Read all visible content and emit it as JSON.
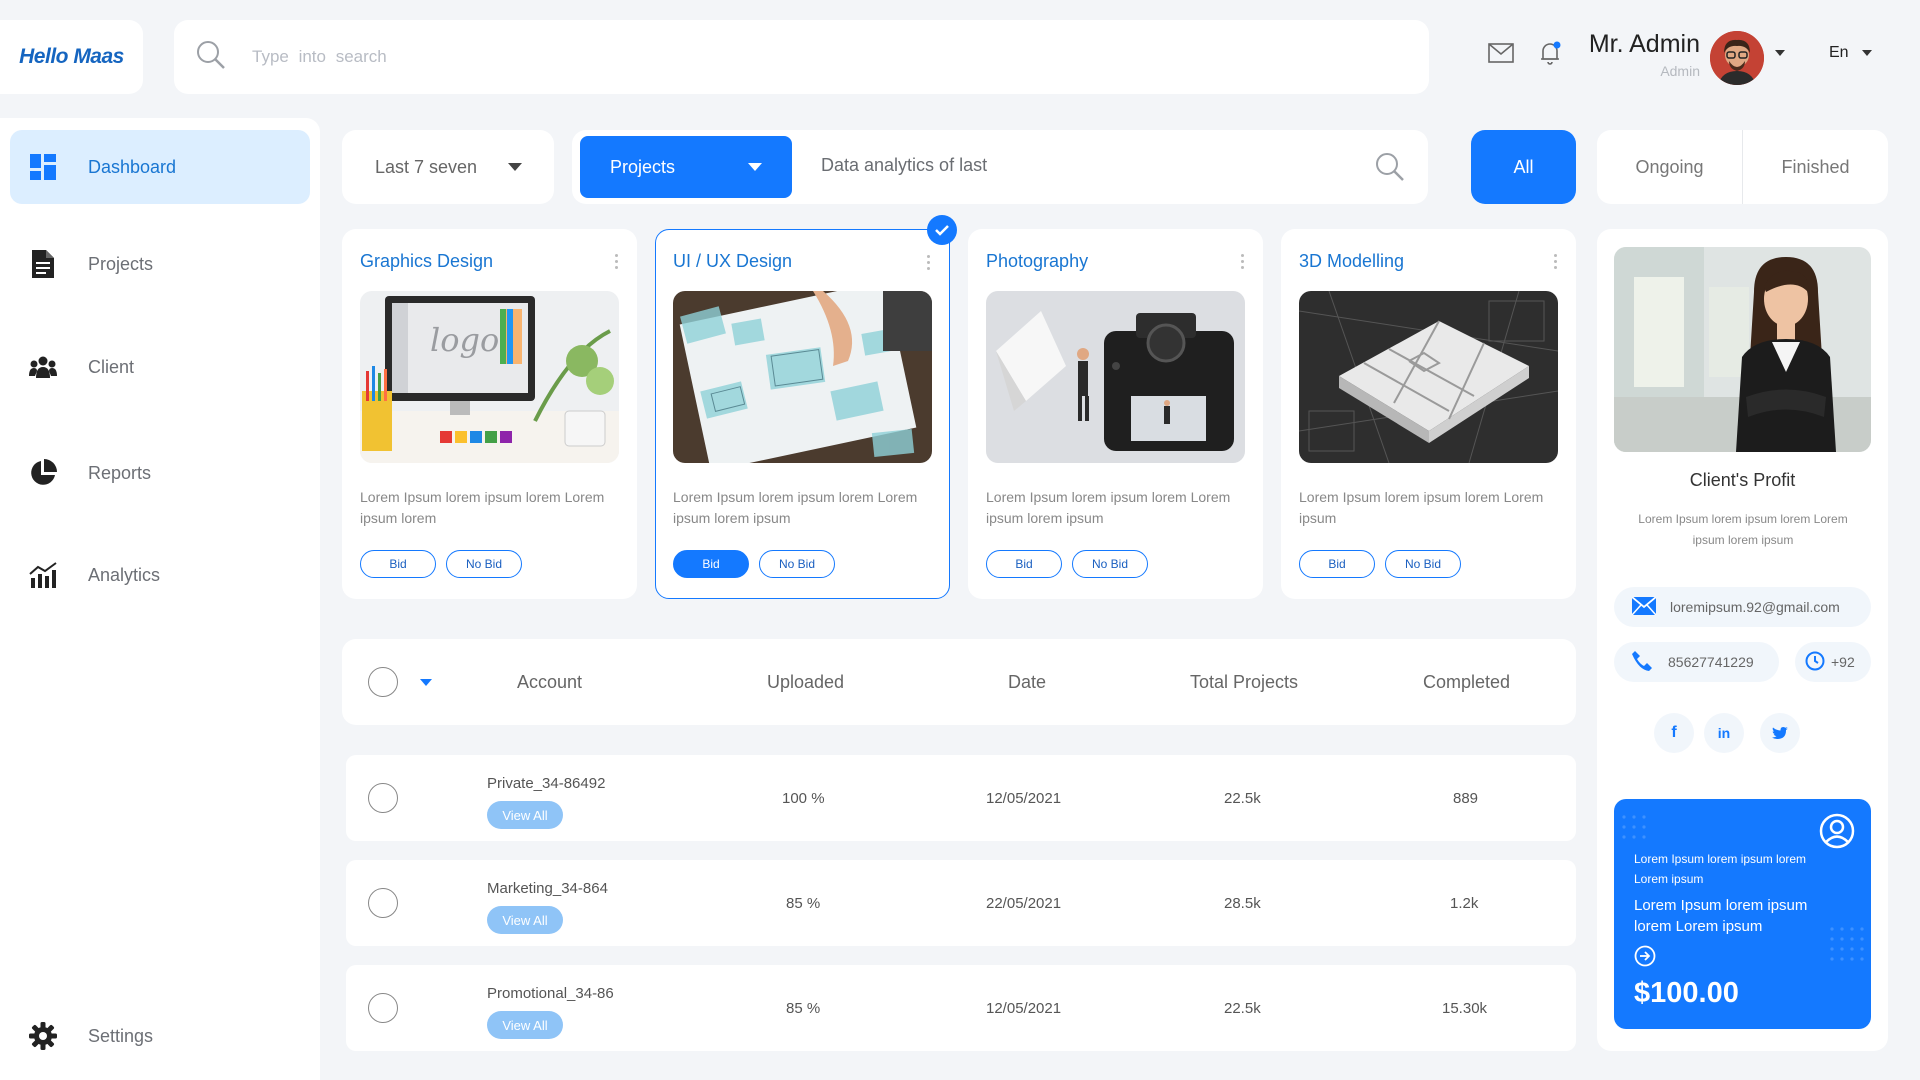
{
  "app": {
    "brand": "Hello Maas"
  },
  "header": {
    "search_placeholder": "Type  into  search",
    "user_name": "Mr. Admin",
    "user_role": "Admin",
    "language": "En"
  },
  "sidebar": {
    "items": [
      {
        "label": "Dashboard",
        "icon": "dashboard-icon",
        "active": true
      },
      {
        "label": "Projects",
        "icon": "document-icon"
      },
      {
        "label": "Client",
        "icon": "users-icon"
      },
      {
        "label": "Reports",
        "icon": "pie-chart-icon"
      },
      {
        "label": "Analytics",
        "icon": "bar-chart-icon"
      }
    ],
    "settings_label": "Settings"
  },
  "filters": {
    "period": "Last 7 seven",
    "category": "Projects",
    "search_text": "Data analytics of last",
    "tabs": [
      "All",
      "Ongoing",
      "Finished"
    ]
  },
  "projects": [
    {
      "title": "Graphics Design",
      "desc": "Lorem Ipsum lorem ipsum lorem Lorem ipsum lorem",
      "bid": "Bid",
      "nobid": "No Bid"
    },
    {
      "title": "UI / UX Design",
      "desc": "Lorem Ipsum lorem ipsum lorem Lorem ipsum lorem ipsum",
      "bid": "Bid",
      "nobid": "No Bid",
      "selected": true
    },
    {
      "title": "Photography",
      "desc": "Lorem Ipsum lorem ipsum lorem Lorem ipsum lorem ipsum",
      "bid": "Bid",
      "nobid": "No Bid"
    },
    {
      "title": "3D Modelling",
      "desc": "Lorem Ipsum lorem ipsum lorem Lorem ipsum",
      "bid": "Bid",
      "nobid": "No Bid"
    }
  ],
  "table": {
    "columns": [
      "Account",
      "Uploaded",
      "Date",
      "Total Projects",
      "Completed"
    ],
    "view_label": "View All",
    "rows": [
      {
        "account": "Private_34-86492",
        "uploaded": "100 %",
        "date": "12/05/2021",
        "total": "22.5k",
        "completed": "889"
      },
      {
        "account": "Marketing_34-864",
        "uploaded": "85 %",
        "date": "22/05/2021",
        "total": "28.5k",
        "completed": "1.2k"
      },
      {
        "account": "Promotional_34-86",
        "uploaded": "85 %",
        "date": "12/05/2021",
        "total": "22.5k",
        "completed": "15.30k"
      }
    ]
  },
  "profile": {
    "title": "Client's Profit",
    "desc": "Lorem Ipsum lorem ipsum lorem Lorem ipsum lorem ipsum",
    "email": "loremipsum.92@gmail.com",
    "phone": "85627741229",
    "code": "+92",
    "socials": [
      "f",
      "in"
    ],
    "promo_small": "Lorem Ipsum lorem ipsum lorem Lorem ipsum",
    "promo_big": "Lorem Ipsum lorem ipsum lorem Lorem ipsum",
    "promo_price": "$100.00"
  },
  "colors": {
    "accent": "#1479ff",
    "link": "#1976d2",
    "active_bg": "#dceeff"
  }
}
